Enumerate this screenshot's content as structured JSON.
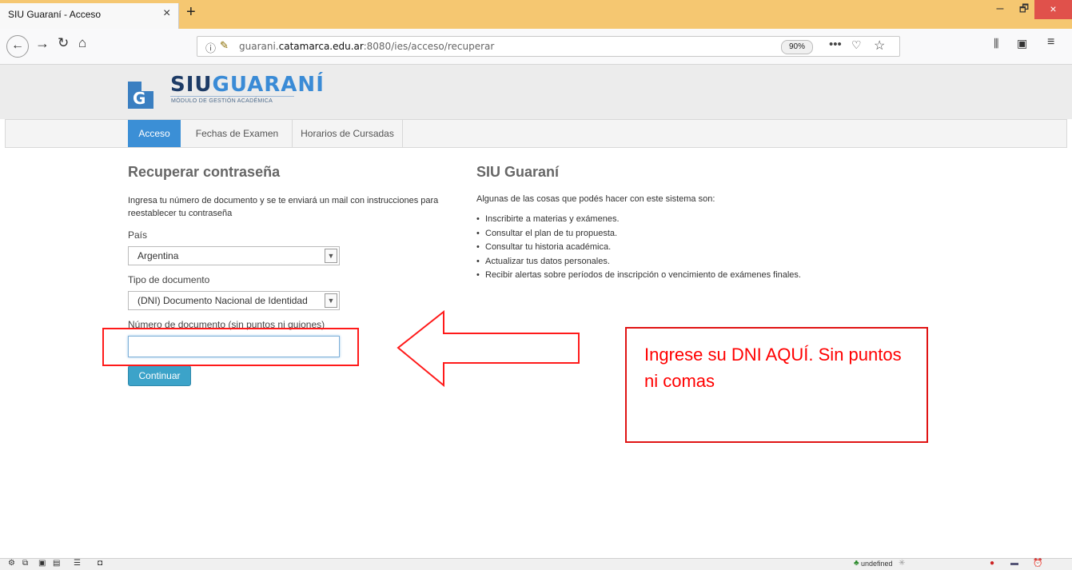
{
  "browser": {
    "tab_title": "SIU Guaraní - Acceso",
    "tab_close": "×",
    "new_tab": "+",
    "url_prefix": "guarani.",
    "url_domain": "catamarca.edu.ar",
    "url_suffix": ":8080/ies/acceso/recuperar",
    "zoom": "90%",
    "window_minimize": "–",
    "window_maximize": "🗗",
    "window_close": "×",
    "more_icon": "•••"
  },
  "site": {
    "logo_siu": "SIU",
    "logo_guarani": "GUARANÍ",
    "logo_subtitle": "MÓDULO DE GESTIÓN ACADÉMICA",
    "logo_letter": "G",
    "nav": {
      "acceso": "Acceso",
      "fechas": "Fechas de Examen",
      "horarios": "Horarios de Cursadas"
    }
  },
  "form": {
    "title": "Recuperar contraseña",
    "description": "Ingresa tu número de documento y se te enviará un mail con instrucciones para reestablecer tu contraseña",
    "pais_label": "País",
    "pais_value": "Argentina",
    "tipo_label": "Tipo de documento",
    "tipo_value": "(DNI) Documento Nacional de Identidad",
    "numero_label": "Número de documento (sin puntos ni guiones)",
    "numero_value": "",
    "continuar": "Continuar"
  },
  "info": {
    "title": "SIU Guaraní",
    "intro": "Algunas de las cosas que podés hacer con este sistema son:",
    "items": [
      "Inscribirte a materias y exámenes.",
      "Consultar el plan de tu propuesta.",
      "Consultar tu historia académica.",
      "Actualizar tus datos personales.",
      "Recibir alertas sobre períodos de inscripción o vencimiento de exámenes finales."
    ]
  },
  "annotation": {
    "note": "Ingrese su DNI AQUÍ. Sin puntos ni comas",
    "color": "#ff0000"
  },
  "statusbar": {
    "undefined_text": "undefined"
  }
}
